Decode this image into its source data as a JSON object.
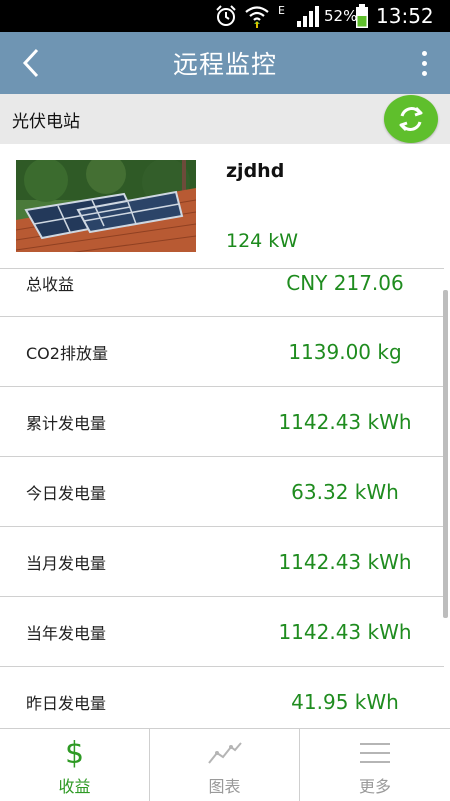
{
  "status_bar": {
    "network_label": "E",
    "battery_percent": "52%",
    "time": "13:52",
    "icons": [
      "alarm-icon",
      "wifi-icon",
      "signal-icon",
      "battery-icon"
    ]
  },
  "app_bar": {
    "title": "远程监控",
    "back_icon": "back-arrow-icon",
    "menu_icon": "more-vertical-icon"
  },
  "station": {
    "header_label": "光伏电站",
    "refresh_icon": "refresh-icon",
    "name": "zjdhd",
    "power": "124 kW",
    "photo_icon": "solar-panel-photo"
  },
  "stats": [
    {
      "label": "总收益",
      "value": "CNY 217.06"
    },
    {
      "label": "CO2排放量",
      "value": "1139.00 kg"
    },
    {
      "label": "累计发电量",
      "value": "1142.43 kWh"
    },
    {
      "label": "今日发电量",
      "value": "63.32 kWh"
    },
    {
      "label": "当月发电量",
      "value": "1142.43 kWh"
    },
    {
      "label": "当年发电量",
      "value": "1142.43 kWh"
    },
    {
      "label": "昨日发电量",
      "value": "41.95 kWh"
    }
  ],
  "tabs": [
    {
      "label": "收益",
      "icon": "dollar-icon",
      "active": true
    },
    {
      "label": "图表",
      "icon": "chart-line-icon",
      "active": false
    },
    {
      "label": "更多",
      "icon": "menu-lines-icon",
      "active": false
    }
  ],
  "colors": {
    "app_bar": "#6f95b3",
    "value_green": "#1f8c1f",
    "active_tab": "#2e9a24",
    "inactive_tab": "#9a9a9a",
    "refresh_button": "#5fbf2c"
  }
}
